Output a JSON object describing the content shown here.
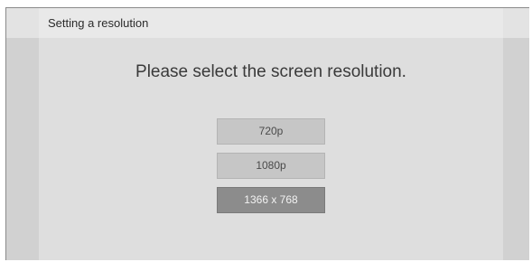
{
  "dialog": {
    "title": "Setting a resolution",
    "prompt": "Please select the screen resolution."
  },
  "options": [
    {
      "label": "720p",
      "selected": false
    },
    {
      "label": "1080p",
      "selected": false
    },
    {
      "label": "1366 x 768",
      "selected": true
    }
  ]
}
